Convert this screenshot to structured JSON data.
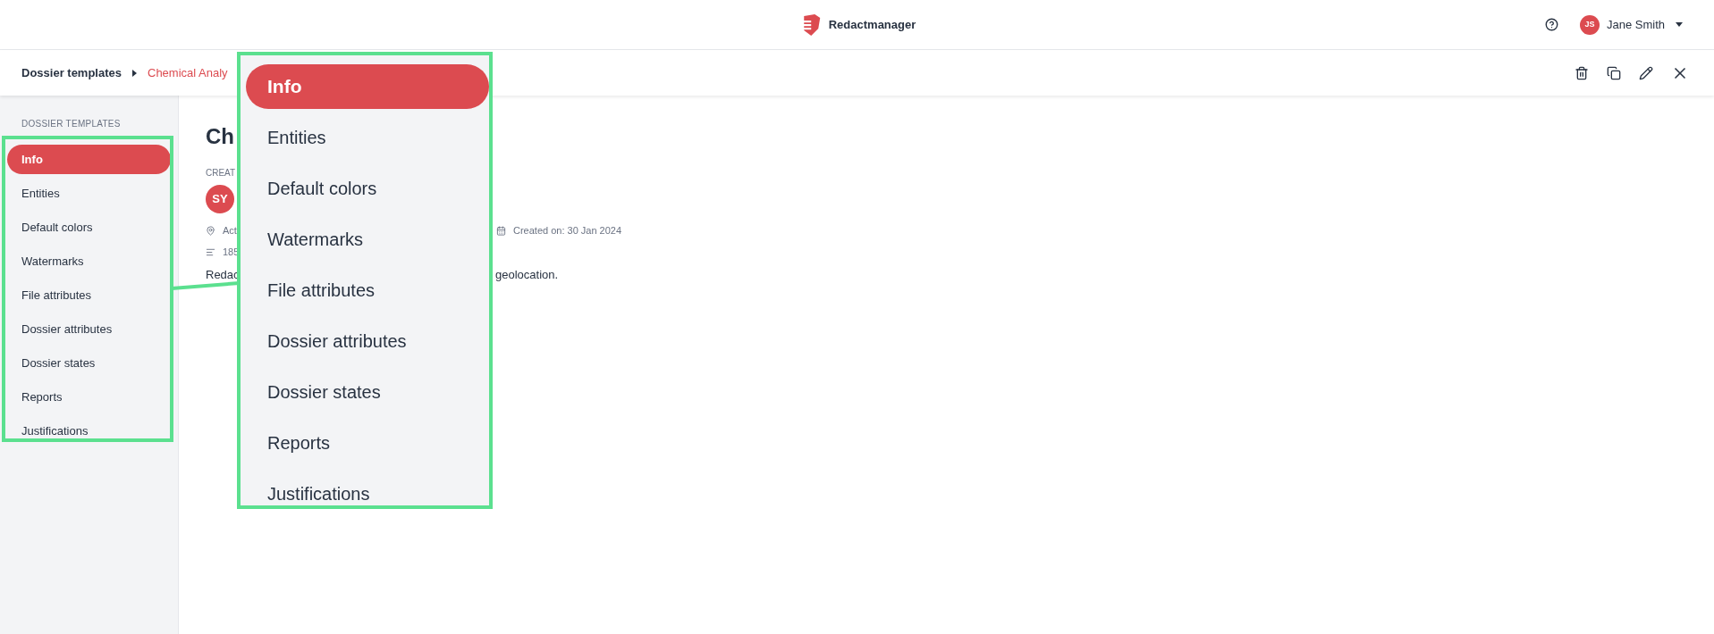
{
  "header": {
    "app_name": "Redactmanager",
    "user": {
      "initials": "JS",
      "name": "Jane Smith"
    }
  },
  "breadcrumb": [
    {
      "label": "Dossier templates",
      "selected": false
    },
    {
      "label": "Chemical Analy",
      "selected": true
    }
  ],
  "sidebar": {
    "heading": "DOSSIER TEMPLATES",
    "items": [
      {
        "label": "Info",
        "selected": true
      },
      {
        "label": "Entities",
        "selected": false
      },
      {
        "label": "Default colors",
        "selected": false
      },
      {
        "label": "Watermarks",
        "selected": false
      },
      {
        "label": "File attributes",
        "selected": false
      },
      {
        "label": "Dossier attributes",
        "selected": false
      },
      {
        "label": "Dossier states",
        "selected": false
      },
      {
        "label": "Reports",
        "selected": false
      },
      {
        "label": "Justifications",
        "selected": false
      }
    ]
  },
  "content": {
    "title": "Ch",
    "created_by_label": "CREAT",
    "avatar_initials": "SY",
    "location": "Act",
    "created_on": "Created on: 30 Jan 2024",
    "count": "185",
    "description_start": "Redac",
    "description_end": "geolocation."
  },
  "callout": {
    "items": [
      {
        "label": "Info",
        "selected": true
      },
      {
        "label": "Entities",
        "selected": false
      },
      {
        "label": "Default colors",
        "selected": false
      },
      {
        "label": "Watermarks",
        "selected": false
      },
      {
        "label": "File attributes",
        "selected": false
      },
      {
        "label": "Dossier attributes",
        "selected": false
      },
      {
        "label": "Dossier states",
        "selected": false
      },
      {
        "label": "Reports",
        "selected": false
      },
      {
        "label": "Justifications",
        "selected": false
      }
    ]
  }
}
